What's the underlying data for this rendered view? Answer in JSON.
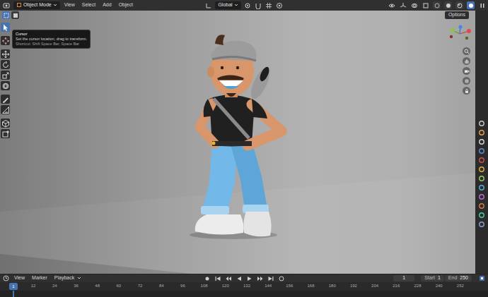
{
  "header": {
    "mode": "Object Mode",
    "menus": [
      "View",
      "Select",
      "Add",
      "Object"
    ],
    "orientation": "Global"
  },
  "tool_settings": {
    "options": "Options"
  },
  "toolbar": {
    "tools": [
      {
        "selected": true
      },
      {
        "selected": false
      },
      {
        "selected": false
      },
      {
        "selected": false
      },
      {
        "selected": false
      },
      {
        "selected": false
      },
      {
        "selected": false
      },
      {
        "selected": false
      },
      {
        "selected": false
      },
      {
        "selected": false
      }
    ]
  },
  "tooltip": {
    "title": "Cursor",
    "description": "Set the cursor location, drag to transform.",
    "shortcut": "Shortcut: Shift Space Bar, Space Bar"
  },
  "timeline": {
    "menus": [
      {
        "label": "View",
        "kind": "menu"
      },
      {
        "label": "Marker",
        "kind": "menu"
      },
      {
        "label": "Playback",
        "kind": "dropdown"
      }
    ],
    "frame": "1",
    "start_label": "Start",
    "start": "1",
    "end_label": "End",
    "end": "250",
    "playhead": "1",
    "ruler": [
      "12",
      "24",
      "36",
      "48",
      "60",
      "72",
      "84",
      "96",
      "108",
      "120",
      "132",
      "144",
      "156",
      "168",
      "180",
      "192",
      "204",
      "216",
      "228",
      "240",
      "252"
    ]
  }
}
